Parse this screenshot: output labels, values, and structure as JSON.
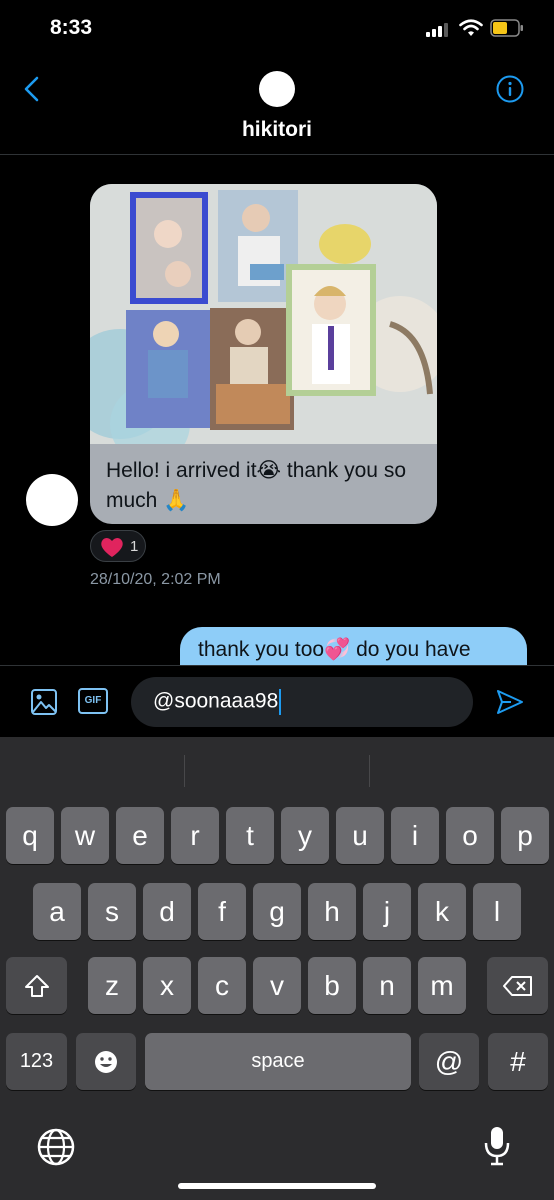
{
  "status": {
    "time": "8:33"
  },
  "header": {
    "title": "hikitori"
  },
  "messages": {
    "incoming": {
      "text": "Hello! i arrived it😭 thank you so much 🙏",
      "reaction": {
        "emoji": "heart",
        "count": "1"
      },
      "timestamp": "28/10/20, 2:02 PM"
    },
    "outgoing": {
      "text": "thank you too💞 do you have"
    }
  },
  "composer": {
    "value": "@soonaaa98",
    "gif_label": "GIF"
  },
  "keyboard": {
    "row1": [
      "q",
      "w",
      "e",
      "r",
      "t",
      "y",
      "u",
      "i",
      "o",
      "p"
    ],
    "row2": [
      "a",
      "s",
      "d",
      "f",
      "g",
      "h",
      "j",
      "k",
      "l"
    ],
    "row3": [
      "z",
      "x",
      "c",
      "v",
      "b",
      "n",
      "m"
    ],
    "numbers_label": "123",
    "space_label": "space",
    "at_label": "@",
    "hash_label": "#"
  },
  "colors": {
    "accent": "#1d9bf0",
    "outgoing_bubble": "#8ecdf8",
    "incoming_bubble": "#a8adb4"
  }
}
